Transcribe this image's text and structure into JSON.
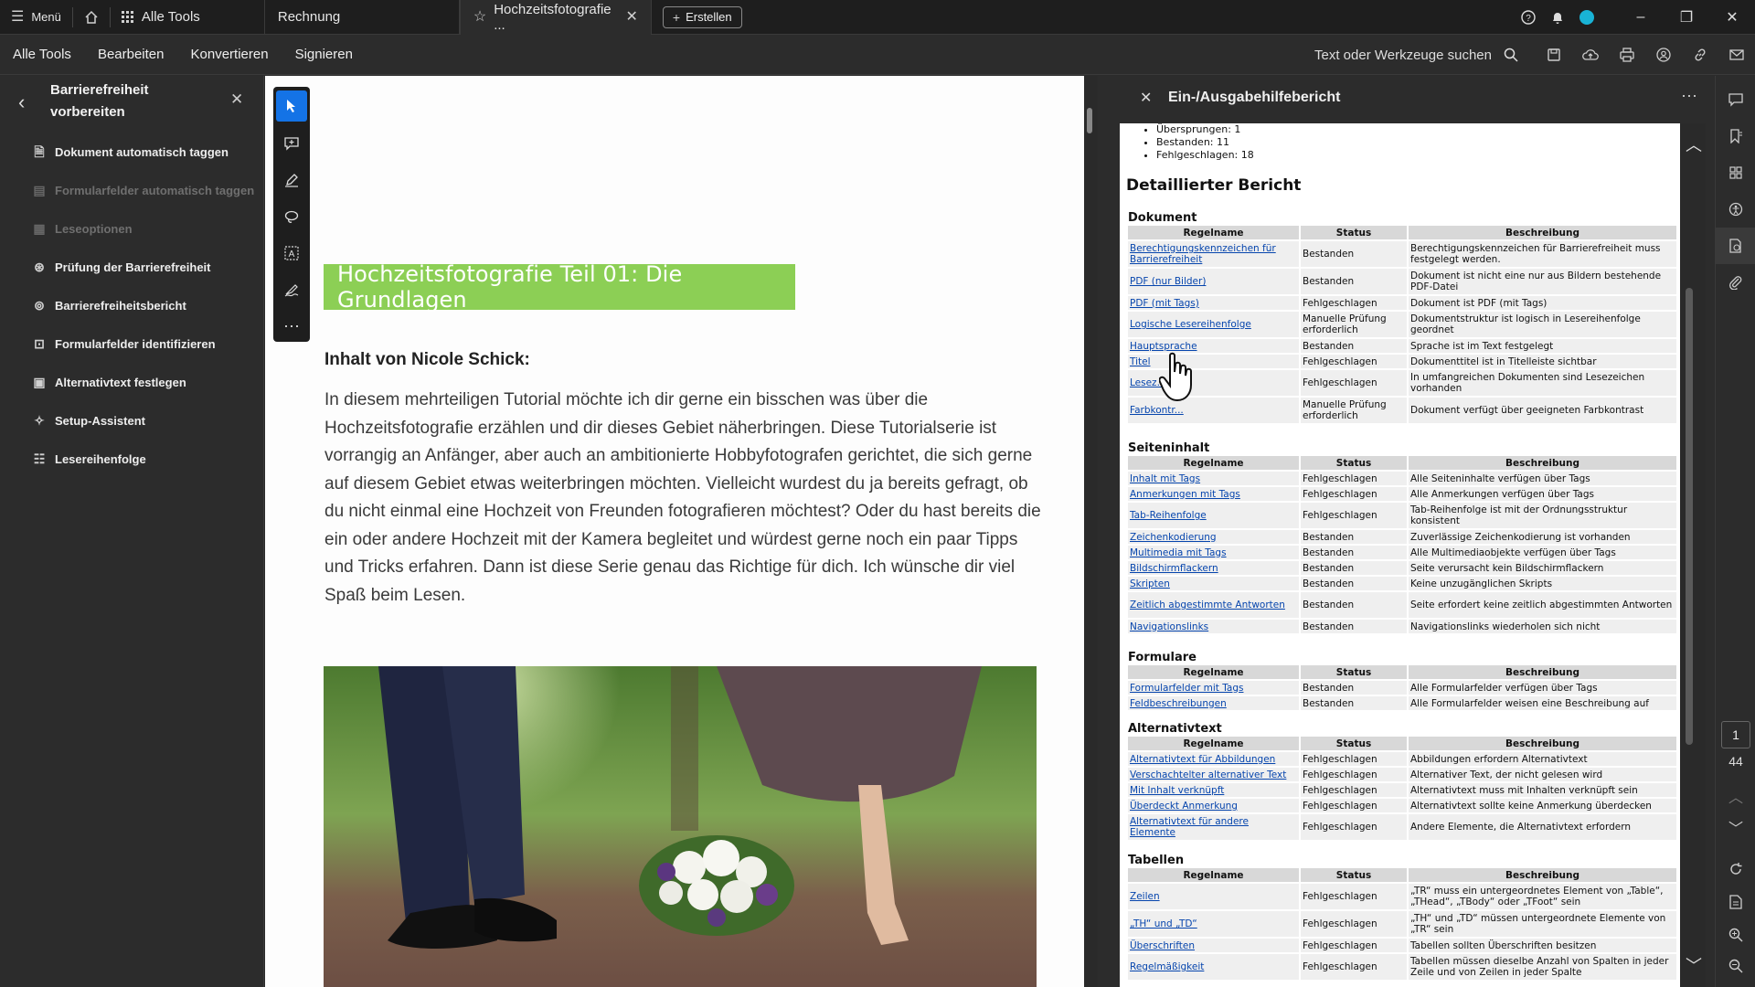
{
  "topbar": {
    "menu_label": "Menü",
    "all_tools_label": "Alle Tools",
    "tabs": [
      {
        "label": "Rechnung"
      },
      {
        "label": "Hochzeitsfotografie ..."
      }
    ],
    "create_label": "Erstellen"
  },
  "menubar": {
    "items": [
      "Alle Tools",
      "Bearbeiten",
      "Konvertieren",
      "Signieren"
    ],
    "search_placeholder": "Text oder Werkzeuge suchen"
  },
  "left_panel": {
    "title": "Barrierefreiheit vorbereiten",
    "items": [
      {
        "label": "Dokument automatisch taggen",
        "enabled": true
      },
      {
        "label": "Formularfelder automatisch taggen",
        "enabled": false
      },
      {
        "label": "Leseoptionen",
        "enabled": false
      },
      {
        "label": "Prüfung der Barrierefreiheit",
        "enabled": true
      },
      {
        "label": "Barrierefreiheitsbericht",
        "enabled": true
      },
      {
        "label": "Formularfelder identifizieren",
        "enabled": true
      },
      {
        "label": "Alternativtext festlegen",
        "enabled": true
      },
      {
        "label": "Setup-Assistent",
        "enabled": true
      },
      {
        "label": "Lesereihenfolge",
        "enabled": true
      }
    ]
  },
  "document": {
    "title": "Hochzeitsfotografie Teil 01: Die Grundlagen",
    "author": "Inhalt von Nicole Schick:",
    "paragraph": "In diesem mehrteiligen Tutorial möchte ich dir gerne ein bisschen was über die Hochzeitsfotografie erzählen und dir dieses Gebiet näherbringen. Diese Tutorialserie ist vorrangig an Anfänger, aber auch an ambitionierte Hobbyfotografen gerichtet, die sich gerne auf diesem Gebiet etwas weiterbringen möchten. Vielleicht wurdest du ja bereits gefragt, ob du nicht einmal eine Hochzeit von Freunden fotografieren möchtest? Oder du hast bereits die ein oder andere Hochzeit mit der Kamera begleitet und würdest gerne noch ein paar Tipps und Tricks erfahren. Dann ist diese Serie genau das Richtige für dich. Ich wünsche dir viel Spaß beim Lesen."
  },
  "report": {
    "panel_title": "Ein-/Ausgabehilfebericht",
    "summary": [
      "Übersprungen: 1",
      "Bestanden: 11",
      "Fehlgeschlagen: 18"
    ],
    "heading": "Detaillierter Bericht",
    "columns": [
      "Regelname",
      "Status",
      "Beschreibung"
    ],
    "sections": [
      {
        "title": "Dokument",
        "rows": [
          [
            "Berechtigungskennzeichen für Barrierefreiheit",
            "Bestanden",
            "Berechtigungskennzeichen für Barrierefreiheit muss festgelegt werden."
          ],
          [
            "PDF (nur Bilder)",
            "Bestanden",
            "Dokument ist nicht eine nur aus Bildern bestehende PDF-Datei"
          ],
          [
            "PDF (mit Tags)",
            "Fehlgeschlagen",
            "Dokument ist PDF (mit Tags)"
          ],
          [
            "Logische Lesereihenfolge",
            "Manuelle Prüfung erforderlich",
            "Dokumentstruktur ist logisch in Lesereihenfolge geordnet"
          ],
          [
            "Hauptsprache",
            "Bestanden",
            "Sprache ist im Text festgelegt"
          ],
          [
            "Titel",
            "Fehlgeschlagen",
            "Dokumenttitel ist in Titelleiste sichtbar"
          ],
          [
            "Lesez...",
            "Fehlgeschlagen",
            "In umfangreichen Dokumenten sind Lesezeichen vorhanden"
          ],
          [
            "Farbkontr...",
            "Manuelle Prüfung erforderlich",
            "Dokument verfügt über geeigneten Farbkontrast"
          ]
        ]
      },
      {
        "title": "Seiteninhalt",
        "rows": [
          [
            "Inhalt mit Tags",
            "Fehlgeschlagen",
            "Alle Seiteninhalte verfügen über Tags"
          ],
          [
            "Anmerkungen mit Tags",
            "Fehlgeschlagen",
            "Alle Anmerkungen verfügen über Tags"
          ],
          [
            "Tab-Reihenfolge",
            "Fehlgeschlagen",
            "Tab-Reihenfolge ist mit der Ordnungsstruktur konsistent"
          ],
          [
            "Zeichenkodierung",
            "Bestanden",
            "Zuverlässige Zeichenkodierung ist vorhanden"
          ],
          [
            "Multimedia mit Tags",
            "Bestanden",
            "Alle Multimediaobjekte verfügen über Tags"
          ],
          [
            "Bildschirmflackern",
            "Bestanden",
            "Seite verursacht kein Bildschirmflackern"
          ],
          [
            "Skripten",
            "Bestanden",
            "Keine unzugänglichen Skripts"
          ],
          [
            "Zeitlich abgestimmte Antworten",
            "Bestanden",
            "Seite erfordert keine zeitlich abgestimmten Antworten"
          ],
          [
            "Navigationslinks",
            "Bestanden",
            "Navigationslinks wiederholen sich nicht"
          ]
        ]
      },
      {
        "title": "Formulare",
        "rows": [
          [
            "Formularfelder mit Tags",
            "Bestanden",
            "Alle Formularfelder verfügen über Tags"
          ],
          [
            "Feldbeschreibungen",
            "Bestanden",
            "Alle Formularfelder weisen eine Beschreibung auf"
          ]
        ]
      },
      {
        "title": "Alternativtext",
        "rows": [
          [
            "Alternativtext für Abbildungen",
            "Fehlgeschlagen",
            "Abbildungen erfordern Alternativtext"
          ],
          [
            "Verschachtelter alternativer Text",
            "Fehlgeschlagen",
            "Alternativer Text, der nicht gelesen wird"
          ],
          [
            "Mit Inhalt verknüpft",
            "Fehlgeschlagen",
            "Alternativtext muss mit Inhalten verknüpft sein"
          ],
          [
            "Überdeckt Anmerkung",
            "Fehlgeschlagen",
            "Alternativtext sollte keine Anmerkung überdecken"
          ],
          [
            "Alternativtext für andere Elemente",
            "Fehlgeschlagen",
            "Andere Elemente, die Alternativtext erfordern"
          ]
        ]
      },
      {
        "title": "Tabellen",
        "rows": [
          [
            "Zeilen",
            "Fehlgeschlagen",
            "„TR“ muss ein untergeordnetes Element von „Table“, „THead“, „TBody“ oder „TFoot“ sein"
          ],
          [
            "„TH“ und „TD“",
            "Fehlgeschlagen",
            "„TH“ und „TD“ müssen untergeordnete Elemente von „TR“ sein"
          ],
          [
            "Überschriften",
            "Fehlgeschlagen",
            "Tabellen sollten Überschriften besitzen"
          ],
          [
            "Regelmäßigkeit",
            "Fehlgeschlagen",
            "Tabellen müssen dieselbe Anzahl von Spalten in jeder Zeile und von Zeilen in jeder Spalte"
          ]
        ]
      }
    ]
  },
  "rail": {
    "page_current": "1",
    "page_total": "44"
  }
}
